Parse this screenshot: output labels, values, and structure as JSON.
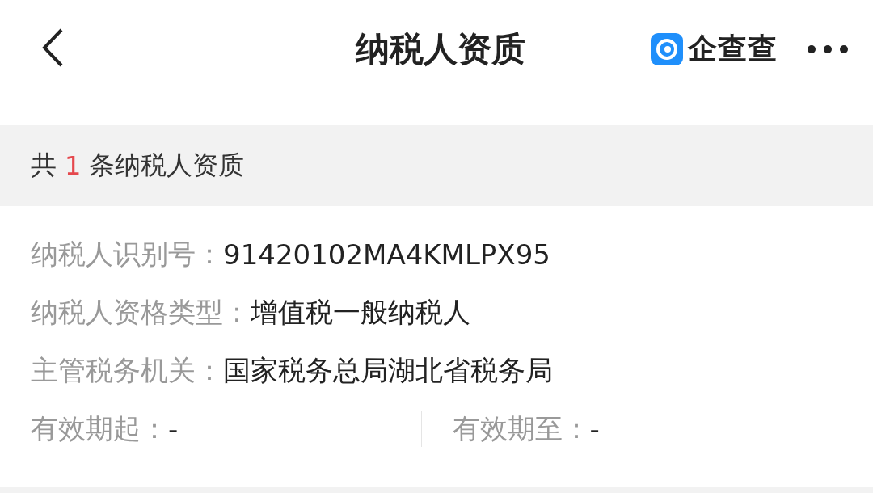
{
  "header": {
    "title": "纳税人资质",
    "brand": "企查查"
  },
  "summary": {
    "prefix": "共",
    "count": "1",
    "suffix": "条纳税人资质"
  },
  "fields": [
    {
      "label": "纳税人识别号：",
      "value": "91420102MA4KMLPX95"
    },
    {
      "label": "纳税人资格类型：",
      "value": "增值税一般纳税人"
    },
    {
      "label": "主管税务机关：",
      "value": "国家税务总局湖北省税务局"
    }
  ],
  "period": [
    {
      "label": "有效期起：",
      "value": "-"
    },
    {
      "label": "有效期至：",
      "value": "-"
    }
  ]
}
